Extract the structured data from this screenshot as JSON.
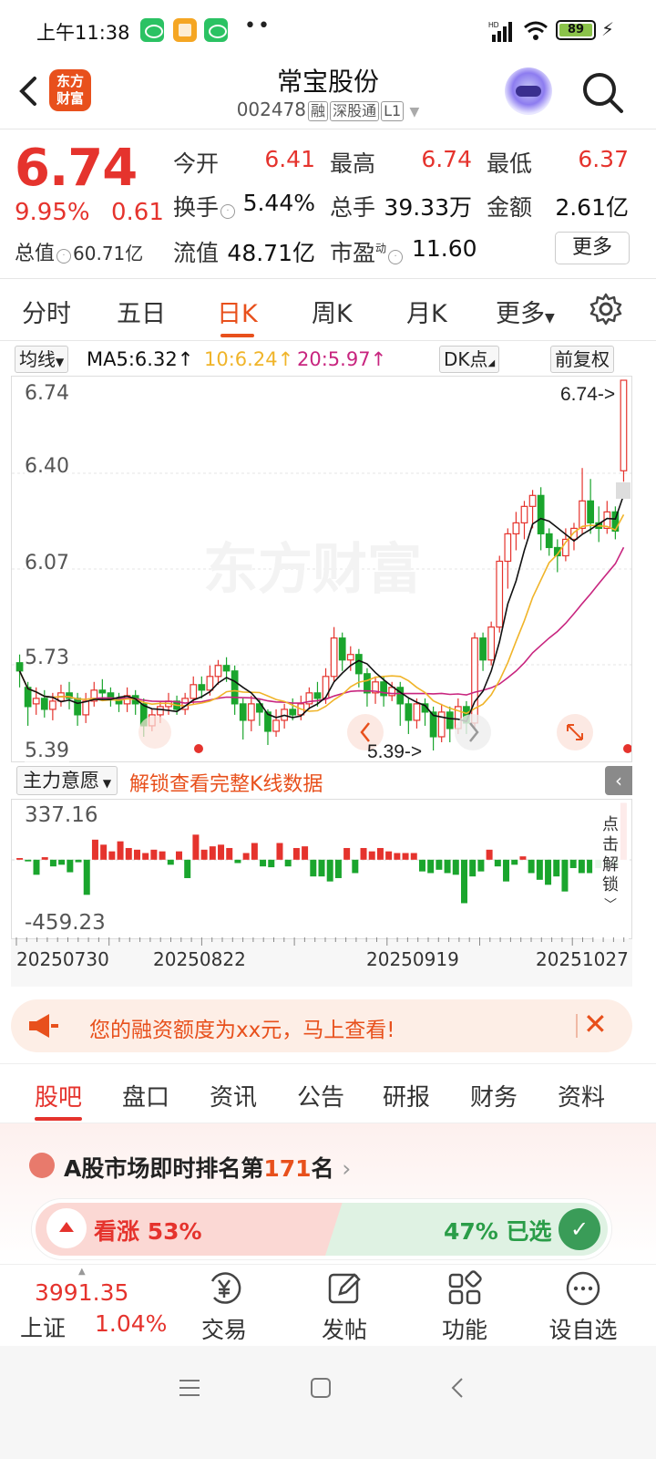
{
  "status_bar": {
    "time": "上午11:38",
    "dots": "••",
    "battery": "89",
    "hd": "HD"
  },
  "header": {
    "logo_line1": "东方",
    "logo_line2": "财富",
    "title": "常宝股份",
    "code": "002478",
    "tag1": "融",
    "tag2": "深股通",
    "tag3": "L1"
  },
  "quote": {
    "price": "6.74",
    "pct": "9.95%",
    "change": "0.61",
    "open_label": "今开",
    "open": "6.41",
    "high_label": "最高",
    "high": "6.74",
    "low_label": "最低",
    "low": "6.37",
    "turnover_label": "换手",
    "turnover": "5.44%",
    "volume_label": "总手",
    "volume": "39.33万",
    "amount_label": "金额",
    "amount": "2.61亿",
    "mcap_label": "总值",
    "mcap": "60.71亿",
    "float_label": "流值",
    "float": "48.71亿",
    "pe_label": "市盈",
    "pe_sup": "动",
    "pe": "11.60",
    "more": "更多"
  },
  "tabs": [
    "分时",
    "五日",
    "日K",
    "周K",
    "月K",
    "更多"
  ],
  "indicators": {
    "ma_select": "均线",
    "ma5": "MA5:6.32",
    "ma10": "10:6.24",
    "ma20": "20:5.97",
    "dk": "DK点",
    "adjust": "前复权"
  },
  "kline_axis": {
    "y1": "6.74",
    "y2": "6.40",
    "y3": "6.07",
    "y4": "5.73",
    "y5": "5.39",
    "max_marker": "6.74->",
    "min_marker": "5.39->",
    "watermark": "东方财富"
  },
  "fund_flow": {
    "select": "主力意愿",
    "link": "解锁查看完整K线数据",
    "ymax": "337.16",
    "ymin": "-459.23",
    "unlock_text": "点击解锁"
  },
  "dates": [
    "20250730",
    "20250822",
    "20250919",
    "20251027"
  ],
  "banner": {
    "text": "您的融资额度为xx元，马上查看!"
  },
  "section_tabs": [
    "股吧",
    "盘口",
    "资讯",
    "公告",
    "研报",
    "财务",
    "资料"
  ],
  "rank": {
    "prefix": "A股市场即时排名第",
    "num": "171",
    "suffix": "名",
    "up_label": "看涨 53%",
    "down_label": "47% 已选"
  },
  "bottom_bar": {
    "index_value": "3991.35",
    "index_name": "上证",
    "index_pct": "1.04%",
    "trade": "交易",
    "post": "发帖",
    "functions": "功能",
    "watch": "设自选"
  },
  "colors": {
    "red": "#e5332d",
    "green": "#1aa52d",
    "ma5": "#111111",
    "ma10": "#f0b429",
    "ma20": "#c8257f",
    "brand": "#e8501c"
  },
  "chart_data": [
    {
      "type": "candlestick",
      "title": "",
      "ylim": [
        5.39,
        6.74
      ],
      "series": [
        {
          "name": "MA5",
          "last": 6.32
        },
        {
          "name": "MA10",
          "last": 6.24
        },
        {
          "name": "MA20",
          "last": 5.97
        }
      ],
      "ohlc": [
        [
          5.71,
          5.68,
          5.74,
          5.62
        ],
        [
          5.62,
          5.55,
          5.64,
          5.48
        ],
        [
          5.56,
          5.58,
          5.62,
          5.52
        ],
        [
          5.58,
          5.54,
          5.61,
          5.51
        ],
        [
          5.54,
          5.57,
          5.6,
          5.5
        ],
        [
          5.57,
          5.6,
          5.63,
          5.55
        ],
        [
          5.6,
          5.58,
          5.64,
          5.54
        ],
        [
          5.58,
          5.52,
          5.6,
          5.48
        ],
        [
          5.52,
          5.57,
          5.6,
          5.49
        ],
        [
          5.57,
          5.61,
          5.64,
          5.55
        ],
        [
          5.61,
          5.6,
          5.65,
          5.57
        ],
        [
          5.6,
          5.58,
          5.62,
          5.55
        ],
        [
          5.58,
          5.56,
          5.6,
          5.53
        ],
        [
          5.56,
          5.59,
          5.62,
          5.53
        ],
        [
          5.59,
          5.56,
          5.61,
          5.52
        ],
        [
          5.56,
          5.48,
          5.58,
          5.44
        ],
        [
          5.48,
          5.52,
          5.54,
          5.46
        ],
        [
          5.52,
          5.55,
          5.57,
          5.49
        ],
        [
          5.55,
          5.57,
          5.6,
          5.52
        ],
        [
          5.57,
          5.54,
          5.59,
          5.52
        ],
        [
          5.54,
          5.58,
          5.6,
          5.52
        ],
        [
          5.58,
          5.63,
          5.66,
          5.56
        ],
        [
          5.63,
          5.61,
          5.66,
          5.58
        ],
        [
          5.61,
          5.66,
          5.7,
          5.59
        ],
        [
          5.66,
          5.7,
          5.72,
          5.63
        ],
        [
          5.7,
          5.68,
          5.73,
          5.64
        ],
        [
          5.68,
          5.56,
          5.7,
          5.52
        ],
        [
          5.56,
          5.5,
          5.58,
          5.43
        ],
        [
          5.5,
          5.56,
          5.59,
          5.46
        ],
        [
          5.56,
          5.53,
          5.58,
          5.48
        ],
        [
          5.53,
          5.46,
          5.54,
          5.41
        ],
        [
          5.46,
          5.5,
          5.54,
          5.44
        ],
        [
          5.5,
          5.54,
          5.56,
          5.47
        ],
        [
          5.54,
          5.52,
          5.58,
          5.5
        ],
        [
          5.52,
          5.56,
          5.59,
          5.5
        ],
        [
          5.56,
          5.6,
          5.62,
          5.54
        ],
        [
          5.6,
          5.58,
          5.64,
          5.55
        ],
        [
          5.58,
          5.66,
          5.69,
          5.56
        ],
        [
          5.66,
          5.8,
          5.84,
          5.64
        ],
        [
          5.8,
          5.72,
          5.82,
          5.68
        ],
        [
          5.72,
          5.74,
          5.77,
          5.68
        ],
        [
          5.74,
          5.67,
          5.76,
          5.62
        ],
        [
          5.67,
          5.6,
          5.69,
          5.55
        ],
        [
          5.6,
          5.64,
          5.66,
          5.56
        ],
        [
          5.64,
          5.59,
          5.66,
          5.55
        ],
        [
          5.59,
          5.62,
          5.64,
          5.57
        ],
        [
          5.62,
          5.56,
          5.64,
          5.48
        ],
        [
          5.56,
          5.5,
          5.58,
          5.45
        ],
        [
          5.5,
          5.56,
          5.58,
          5.47
        ],
        [
          5.56,
          5.53,
          5.58,
          5.48
        ],
        [
          5.53,
          5.44,
          5.55,
          5.39
        ],
        [
          5.44,
          5.53,
          5.56,
          5.42
        ],
        [
          5.53,
          5.47,
          5.55,
          5.42
        ],
        [
          5.47,
          5.55,
          5.58,
          5.45
        ],
        [
          5.55,
          5.49,
          5.57,
          5.45
        ],
        [
          5.49,
          5.8,
          5.82,
          5.47
        ],
        [
          5.8,
          5.72,
          5.82,
          5.68
        ],
        [
          5.72,
          5.84,
          5.86,
          5.7
        ],
        [
          5.84,
          6.08,
          6.1,
          5.82
        ],
        [
          6.08,
          6.18,
          6.2,
          5.98
        ],
        [
          6.18,
          6.22,
          6.26,
          6.12
        ],
        [
          6.22,
          6.28,
          6.3,
          6.16
        ],
        [
          6.28,
          6.32,
          6.34,
          6.2
        ],
        [
          6.32,
          6.18,
          6.35,
          6.12
        ],
        [
          6.18,
          6.13,
          6.2,
          6.1
        ],
        [
          6.13,
          6.1,
          6.16,
          6.04
        ],
        [
          6.1,
          6.16,
          6.2,
          6.08
        ],
        [
          6.16,
          6.2,
          6.22,
          6.12
        ],
        [
          6.2,
          6.3,
          6.42,
          6.18
        ],
        [
          6.3,
          6.22,
          6.38,
          6.18
        ],
        [
          6.22,
          6.2,
          6.28,
          6.15
        ],
        [
          6.2,
          6.26,
          6.3,
          6.18
        ],
        [
          6.26,
          6.19,
          6.28,
          6.16
        ],
        [
          6.41,
          6.74,
          6.74,
          6.37
        ]
      ]
    },
    {
      "type": "bar",
      "title": "主力意愿",
      "ylim": [
        -459.23,
        337.16
      ],
      "values": [
        10,
        -10,
        -90,
        15,
        -40,
        -30,
        -75,
        -15,
        -210,
        120,
        90,
        50,
        110,
        70,
        60,
        40,
        60,
        50,
        -30,
        50,
        -110,
        150,
        60,
        80,
        90,
        70,
        -20,
        40,
        100,
        -40,
        -45,
        100,
        -40,
        70,
        80,
        -100,
        -100,
        -130,
        -110,
        70,
        -80,
        70,
        50,
        70,
        50,
        40,
        40,
        40,
        -70,
        -80,
        -60,
        -80,
        -90,
        -260,
        -100,
        -70,
        60,
        -40,
        -130,
        -30,
        20,
        -80,
        -120,
        -150,
        -100,
        -190,
        -50,
        -80,
        -80,
        -50,
        -40,
        -40,
        340
      ]
    }
  ]
}
